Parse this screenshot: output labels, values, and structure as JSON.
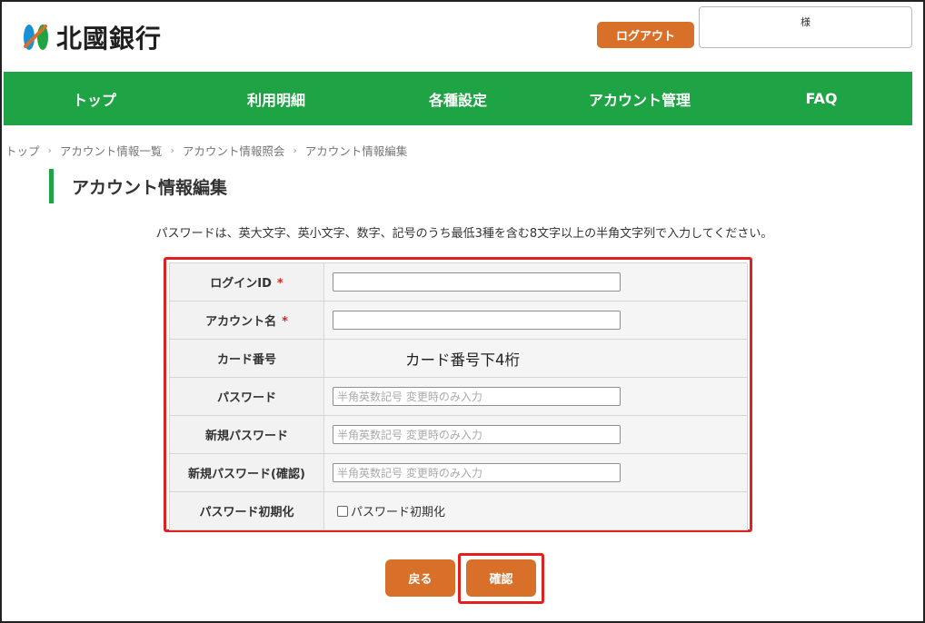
{
  "header": {
    "brand": "北國銀行",
    "logout_label": "ログアウト",
    "user_suffix": "様"
  },
  "nav": {
    "items": [
      {
        "label": "トップ"
      },
      {
        "label": "利用明細"
      },
      {
        "label": "各種設定"
      },
      {
        "label": "アカウント管理"
      },
      {
        "label": "FAQ"
      }
    ]
  },
  "breadcrumb": [
    "トップ",
    "アカウント情報一覧",
    "アカウント情報照会",
    "アカウント情報編集"
  ],
  "page_title": "アカウント情報編集",
  "notice": "パスワードは、英大文字、英小文字、数字、記号のうち最低3種を含む8文字以上の半角文字列で入力してください。",
  "form": {
    "login_id": {
      "label": "ログインID",
      "required": "*",
      "value": ""
    },
    "account_name": {
      "label": "アカウント名",
      "required": "*",
      "value": ""
    },
    "card_number": {
      "label": "カード番号",
      "value": "カード番号下4桁"
    },
    "password": {
      "label": "パスワード",
      "placeholder": "半角英数記号 変更時のみ入力"
    },
    "new_password": {
      "label": "新規パスワード",
      "placeholder": "半角英数記号 変更時のみ入力"
    },
    "new_password_confirm": {
      "label": "新規パスワード(確認)",
      "placeholder": "半角英数記号 変更時のみ入力"
    },
    "password_reset": {
      "label": "パスワード初期化",
      "checkbox_label": "パスワード初期化",
      "checked": false
    }
  },
  "buttons": {
    "back": "戻る",
    "confirm": "確認"
  },
  "colors": {
    "nav_green": "#1ea444",
    "button_orange": "#d9702a",
    "highlight_red": "#e32020"
  }
}
